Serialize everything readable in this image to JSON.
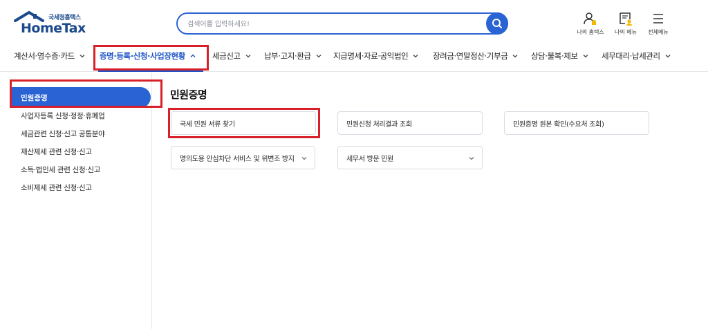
{
  "logo": {
    "sub_text": "국세청홈택스",
    "main_text": "HomeTax"
  },
  "search": {
    "placeholder": "검색어를 입력하세요!"
  },
  "utility": [
    {
      "label": "나의 홈택스",
      "icon": "person-bell-icon"
    },
    {
      "label": "나의 메뉴",
      "icon": "menu-document-icon"
    },
    {
      "label": "전체메뉴",
      "icon": "hamburger-icon"
    }
  ],
  "gnb": {
    "items": [
      {
        "label": "계산서·영수증·카드"
      },
      {
        "label": "증명·등록·신청·사업장현황"
      },
      {
        "label": "세금신고"
      },
      {
        "label": "납부·고지·환급"
      },
      {
        "label": "지급명세·자료·공익법인"
      },
      {
        "label": "장려금·연말정산·기부금"
      },
      {
        "label": "상담·불복·제보"
      },
      {
        "label": "세무대리·납세관리"
      }
    ],
    "active_index": 1
  },
  "sidebar": {
    "active": "민원증명",
    "items": [
      {
        "label": "사업자등록 신청·정정·휴폐업"
      },
      {
        "label": "세금관련 신청·신고 공통분야"
      },
      {
        "label": "재산제세 관련 신청·신고"
      },
      {
        "label": "소득·법인세 관련 신청·신고"
      },
      {
        "label": "소비제세 관련 신청·신고"
      }
    ]
  },
  "main": {
    "title": "민원증명",
    "cards": [
      {
        "label": "국세 민원 서류 찾기",
        "has_dropdown": false
      },
      {
        "label": "민원신청 처리결과 조회",
        "has_dropdown": false
      },
      {
        "label": "민원증명 원본 확인(수요처 조회)",
        "has_dropdown": false
      },
      {
        "label": "명의도용 안심차단 서비스 및 위변조 방지",
        "has_dropdown": true
      },
      {
        "label": "세무서 방문 민원",
        "has_dropdown": true
      }
    ]
  },
  "colors": {
    "brand_blue": "#2a63d4",
    "logo_navy": "#1b4a8c",
    "highlight_red": "#d8202a",
    "border_gray": "#d7dbe2"
  }
}
